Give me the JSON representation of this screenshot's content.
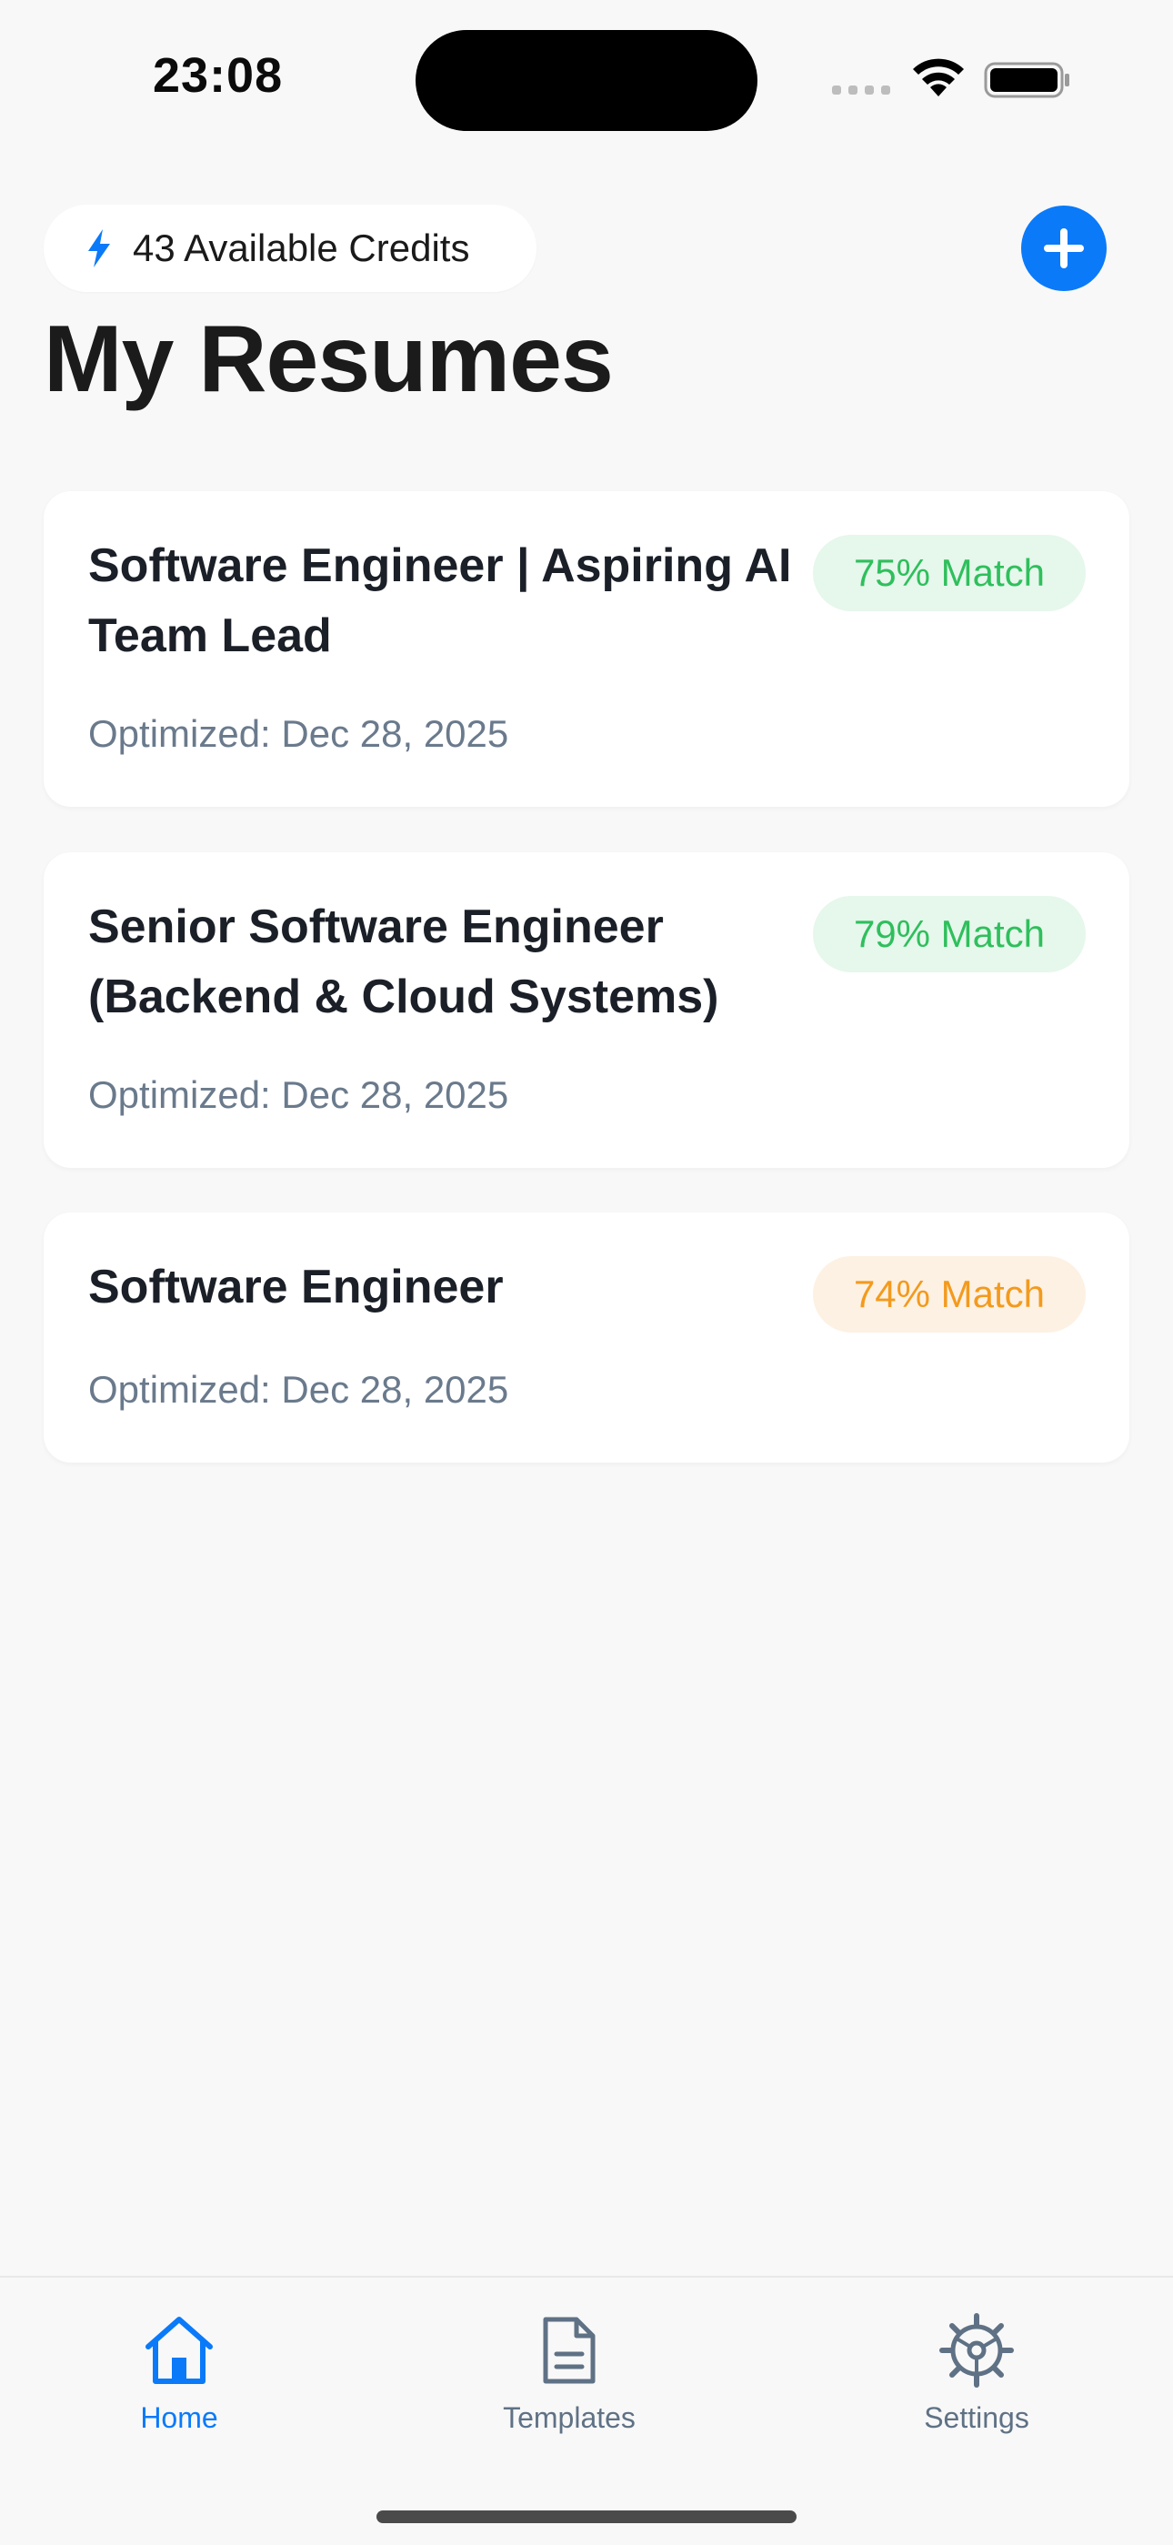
{
  "status_bar": {
    "time": "23:08"
  },
  "header": {
    "credits_text": "43 Available Credits",
    "title": "My Resumes"
  },
  "resumes": [
    {
      "title": "Software Engineer | Aspiring AI Team Lead",
      "date": "Optimized: Dec 28, 2025",
      "match": "75% Match",
      "badge_color": "#2fbf5c"
    },
    {
      "title": "Senior Software Engineer (Backend & Cloud Systems)",
      "date": "Optimized: Dec 28, 2025",
      "match": "79% Match",
      "badge_color": "#2fbf5c"
    },
    {
      "title": "Software Engineer",
      "date": "Optimized: Dec 28, 2025",
      "match": "74% Match",
      "badge_color": "#f39a1d"
    }
  ],
  "tabs": [
    {
      "label": "Home",
      "icon": "home-icon",
      "active": true
    },
    {
      "label": "Templates",
      "icon": "document-icon",
      "active": false
    },
    {
      "label": "Settings",
      "icon": "gear-icon",
      "active": false
    }
  ],
  "colors": {
    "accent": "#0a7af9",
    "inactive_tab": "#5f7185",
    "background": "#f8f8f8"
  }
}
